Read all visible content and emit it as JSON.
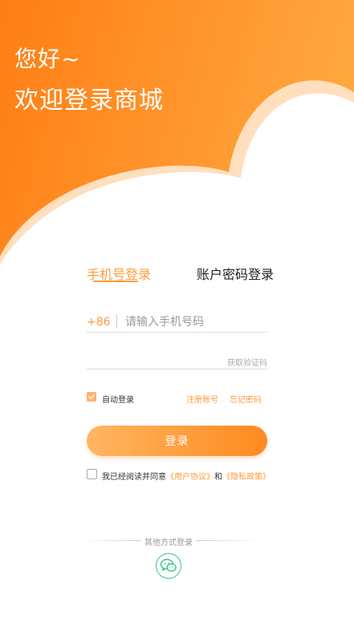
{
  "header": {
    "greeting_line1": "您好~",
    "greeting_line2": "欢迎登录商城"
  },
  "tabs": [
    {
      "label": "手机号登录",
      "active": true
    },
    {
      "label": "账户密码登录",
      "active": false
    }
  ],
  "form": {
    "country_code": "+86",
    "phone_placeholder": "请输入手机号码",
    "code_value": "",
    "get_code_label": "获取验证码",
    "auto_login_label": "自动登录",
    "auto_login_checked": true,
    "register_label": "注册账号",
    "forgot_label": "忘记密码",
    "login_button": "登录",
    "agreement": {
      "checked": false,
      "prefix": "我已经阅读并同意",
      "user_agreement": "《用户协议》",
      "and": "和",
      "privacy_policy": "《隐私政策》"
    }
  },
  "other_login": {
    "label": "其他方式登录",
    "wechat_icon": "wechat-icon"
  },
  "colors": {
    "brand_orange": "#ff8a1f",
    "accent": "#ff9b3d",
    "wechat_green": "#3cc48a"
  }
}
